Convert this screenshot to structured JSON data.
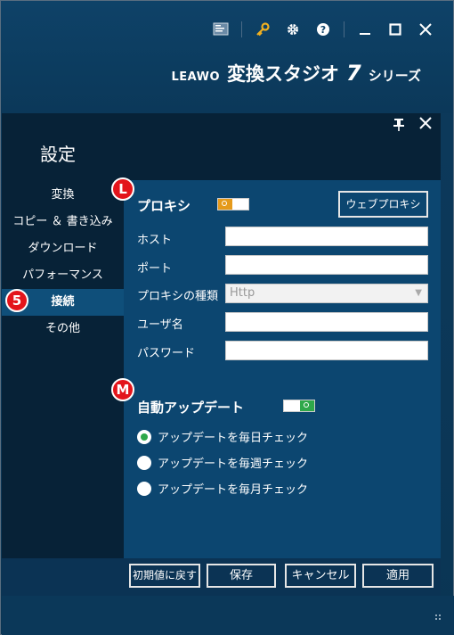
{
  "app": {
    "brand": "LEAWO",
    "title": "変換スタジオ",
    "version": "7",
    "series": "シリーズ"
  },
  "titlebar_icons": [
    "screen-icon",
    "key-icon",
    "gear-icon",
    "help-icon",
    "minimize-icon",
    "maximize-icon",
    "close-icon"
  ],
  "panel": {
    "title": "設定",
    "sidebar": [
      {
        "label": "変換",
        "active": false
      },
      {
        "label": "コピー ＆ 書き込み",
        "active": false
      },
      {
        "label": "ダウンロード",
        "active": false
      },
      {
        "label": "パフォーマンス",
        "active": false
      },
      {
        "label": "接続",
        "active": true
      },
      {
        "label": "その他",
        "active": false
      }
    ],
    "proxy": {
      "badge": "L",
      "title": "プロキシ",
      "toggle": "off",
      "web_proxy_button": "ウェブプロキシ",
      "host_label": "ホスト",
      "host_value": "",
      "port_label": "ポート",
      "port_value": "",
      "type_label": "プロキシの種類",
      "type_value": "Http",
      "user_label": "ユーザ名",
      "user_value": "",
      "password_label": "パスワード",
      "password_value": ""
    },
    "update": {
      "badge": "M",
      "title": "自動アップデート",
      "toggle": "on",
      "options": [
        {
          "label": "アップデートを毎日チェック",
          "checked": true
        },
        {
          "label": "アップデートを毎週チェック",
          "checked": false
        },
        {
          "label": "アップデートを毎月チェック",
          "checked": false
        }
      ]
    },
    "sidebar_badge": "5"
  },
  "footer": {
    "reset": "初期値に戻す",
    "save": "保存",
    "cancel": "キャンセル",
    "apply": "適用"
  },
  "colors": {
    "accent_green": "#2ea84a",
    "toggle_orange": "#e59a1b",
    "badge_red": "#e3141b"
  }
}
